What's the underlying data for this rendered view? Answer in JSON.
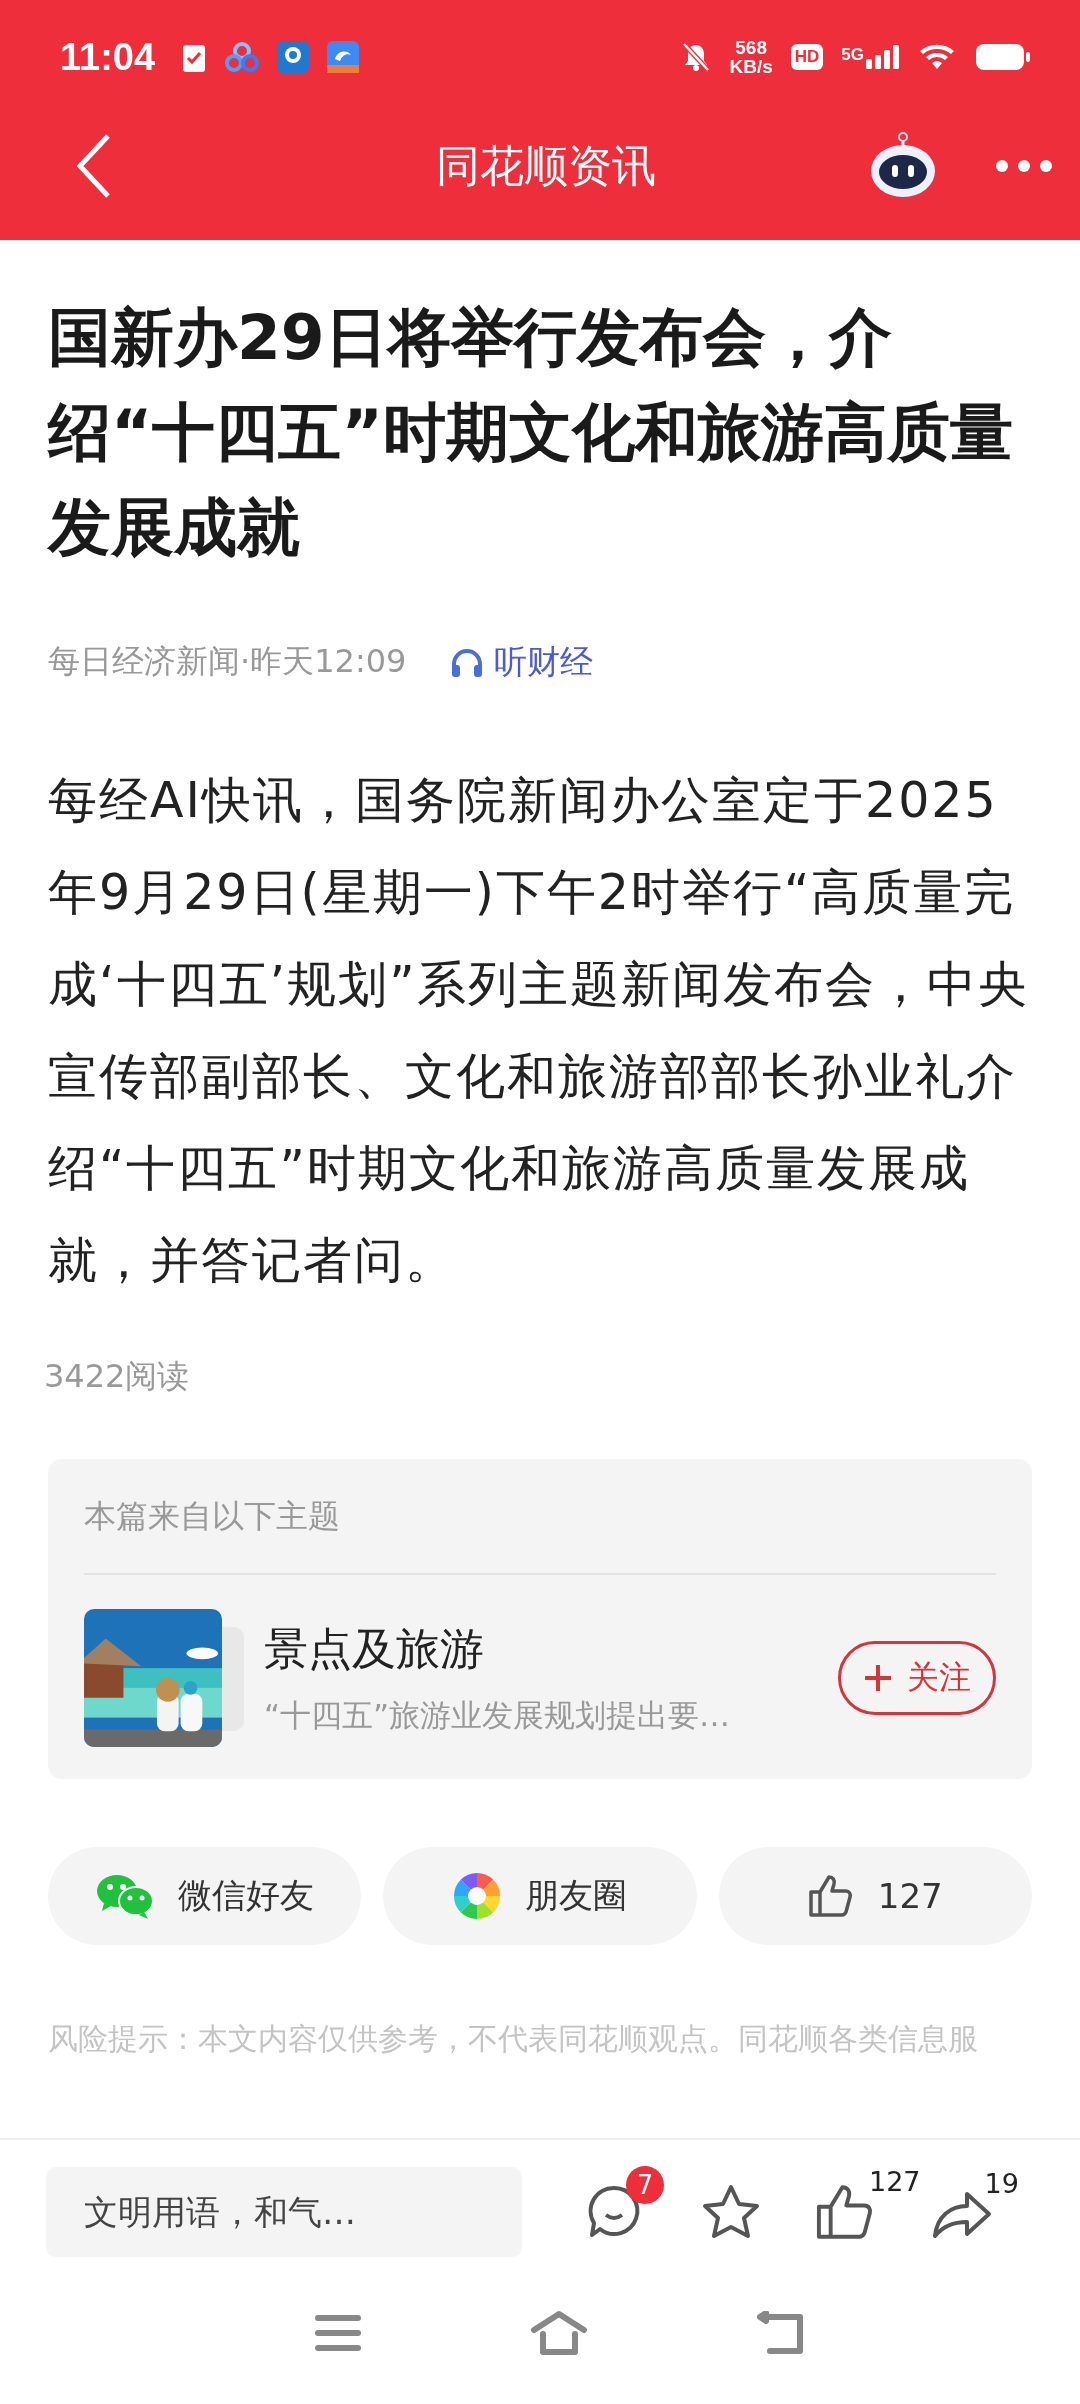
{
  "status_bar": {
    "time": "11:04",
    "net_speed": "568",
    "net_unit": "KB/s",
    "hd": "HD",
    "network": "5G"
  },
  "header": {
    "title": "同花顺资讯"
  },
  "article": {
    "title": "国新办29日将举行发布会，介绍“十四五”时期文化和旅游高质量发展成就",
    "meta": "每日经济新闻·昨天12:09",
    "listen": "听财经",
    "body": "每经AI快讯，国务院新闻办公室定于2025年9月29日(星期一)下午2时举行“高质量完成‘十四五’规划”系列主题新闻发布会，中央宣传部副部长、文化和旅游部部长孙业礼介绍“十四五”时期文化和旅游高质量发展成就，并答记者问。",
    "reads": "3422阅读"
  },
  "topic_card": {
    "heading": "本篇来自以下主题",
    "topic": {
      "kind": "picture",
      "name": "景点及旅游",
      "description": "“十四五”旅游业发展规划提出要…",
      "follow_label": "关注",
      "followed": false
    }
  },
  "share": [
    {
      "kind": "wechat",
      "label": "微信好友"
    },
    {
      "kind": "moments",
      "label": "朋友圈"
    },
    {
      "kind": "like",
      "label": "127"
    }
  ],
  "disclaimer": "风险提示：本文内容仅供参考，不代表同花顺观点。同花顺各类信息服",
  "bottom_bar": {
    "comment_placeholder": "文明用语，和气…",
    "comment_count": "7",
    "like_count": "127",
    "share_count": "19"
  }
}
